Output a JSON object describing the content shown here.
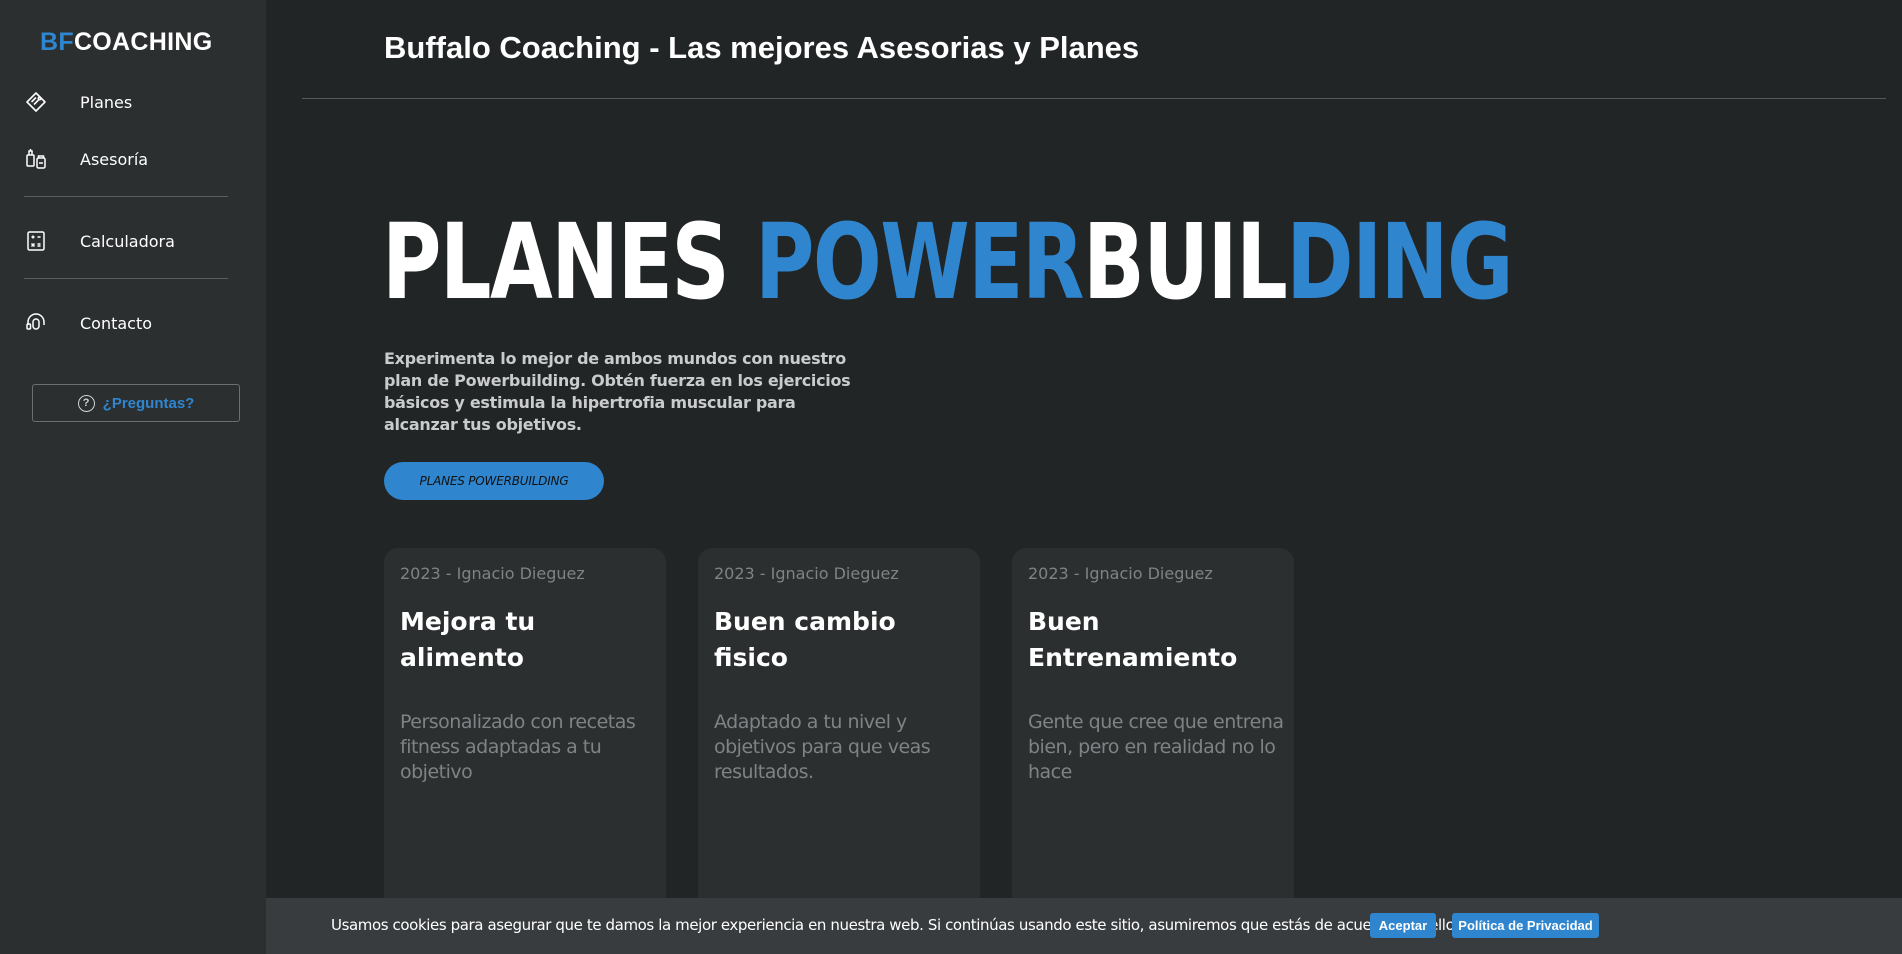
{
  "sidebar": {
    "logo_bf": "BF",
    "logo_coaching": "COACHING",
    "items": [
      {
        "label": "Planes",
        "icon": "dumbbell-tag-icon"
      },
      {
        "label": "Asesoría",
        "icon": "supplements-icon"
      },
      {
        "label": "Calculadora",
        "icon": "calculator-icon"
      },
      {
        "label": "Contacto",
        "icon": "headset-icon"
      }
    ],
    "questions_label": "¿Preguntas?"
  },
  "header": {
    "title": "Buffalo Coaching - Las mejores Asesorias y Planes"
  },
  "hero": {
    "word1": "PLANES ",
    "word2a": "POWER",
    "word2b": "BUIL",
    "word2c": "DING",
    "description": "Experimenta lo mejor de ambos mundos con nuestro plan de Powerbuilding. Obtén fuerza en los ejercicios básicos y estimula la hipertrofia muscular para alcanzar tus objetivos.",
    "cta_label": "PLANES POWERBUILDING"
  },
  "cards": [
    {
      "meta": "2023 - Ignacio Dieguez",
      "title": "Mejora tu alimento",
      "desc": "Personalizado con recetas fitness adaptadas a tu objetivo"
    },
    {
      "meta": "2023 - Ignacio Dieguez",
      "title": "Buen cambio fisico",
      "desc": "Adaptado a tu nivel y objetivos para que veas resultados."
    },
    {
      "meta": "2023 - Ignacio Dieguez",
      "title": "Buen Entrenamiento",
      "desc": "Gente que cree que entrena bien, pero en realidad no lo hace"
    }
  ],
  "cookie": {
    "text": "Usamos cookies para asegurar que te damos la mejor experiencia en nuestra web. Si continúas usando este sitio, asumiremos que estás de acuerdo con ello.",
    "accept_label": "Aceptar",
    "privacy_label": "Política de Privacidad"
  },
  "colors": {
    "accent": "#2f86cf",
    "background": "#212526",
    "sidebar": "#2b2f30"
  }
}
